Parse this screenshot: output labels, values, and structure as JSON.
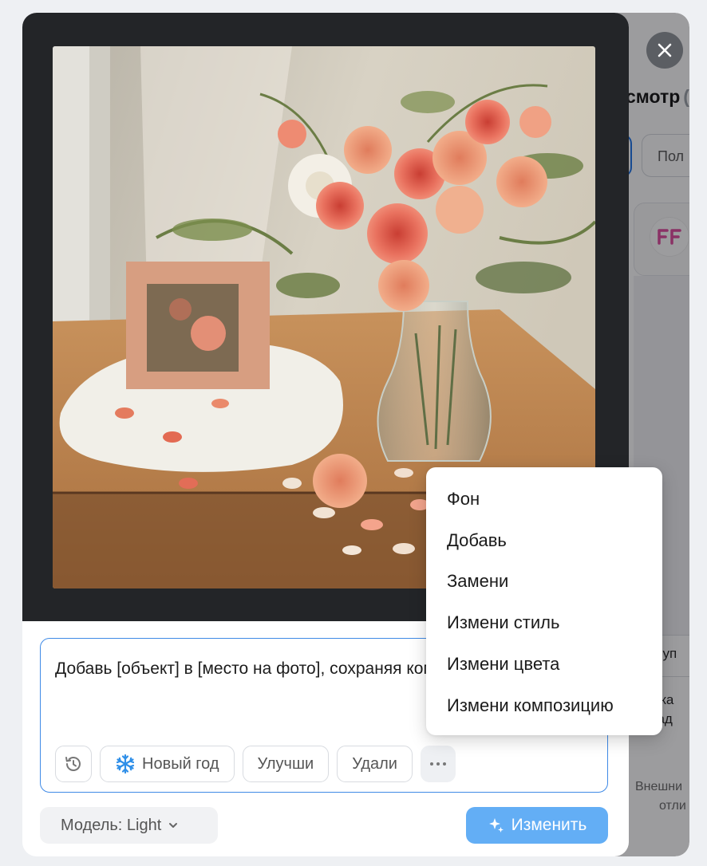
{
  "background_page": {
    "heading": "смотр",
    "heading_extra": "(",
    "chip_label": "Пол",
    "row1": "ступ",
    "row2a": "ажа",
    "row2b": "рад",
    "row3a": "Внешни",
    "row3b": "отли"
  },
  "modal": {
    "prompt": {
      "text": "Добавь [объект] в [место на фото], сохраняя композицию и стиль"
    },
    "chips": {
      "new_year": "Новый год",
      "improve": "Улучши",
      "remove": "Удали"
    },
    "model_label": "Модель: Light",
    "apply_label": "Изменить"
  },
  "menu": {
    "items": [
      {
        "label": "Фон"
      },
      {
        "label": "Добавь"
      },
      {
        "label": "Замени"
      },
      {
        "label": "Измени стиль"
      },
      {
        "label": "Измени цвета"
      },
      {
        "label": "Измени композицию"
      }
    ]
  },
  "icons": {
    "close": "close-icon",
    "history": "history-icon",
    "snowflake": "snowflake-icon",
    "more": "more-dots-icon",
    "chevron": "chevron-down-icon",
    "sparkle": "sparkle-icon"
  },
  "colors": {
    "accent": "#3f8ae6",
    "apply_button": "#63aef5",
    "viewer_bg": "#232528"
  }
}
